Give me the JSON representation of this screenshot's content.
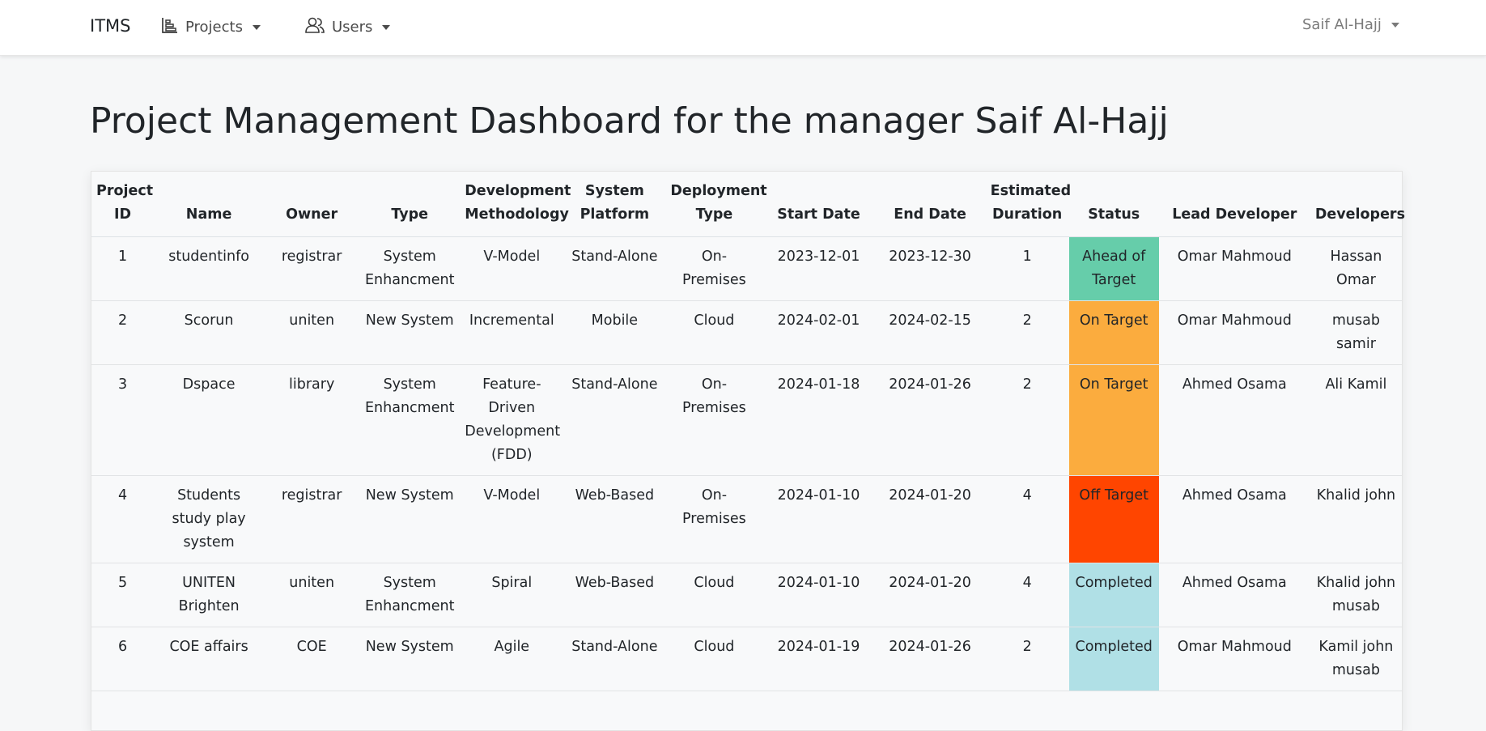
{
  "nav": {
    "brand": "ITMS",
    "projects_label": "Projects",
    "users_label": "Users",
    "user_label": "Saif Al-Hajj"
  },
  "page": {
    "title": "Project Management Dashboard for the manager Saif Al-Hajj"
  },
  "table": {
    "headers": [
      "Project ID",
      "Name",
      "Owner",
      "Type",
      "Development Methodology",
      "System Platform",
      "Deployment Type",
      "Start Date",
      "End Date",
      "Estimated Duration",
      "Status",
      "Lead Developer",
      "Developers"
    ],
    "rows": [
      {
        "id": "1",
        "name": "studentinfo",
        "owner": "registrar",
        "type": "System Enhancment",
        "method": "V-Model",
        "platform": "Stand-Alone",
        "deploy": "On-Premises",
        "start": "2023-12-01",
        "end": "2023-12-30",
        "duration": "1",
        "status": "Ahead of Target",
        "status_color": "#66cdaa",
        "lead": "Omar Mahmoud",
        "devs": "Hassan Omar"
      },
      {
        "id": "2",
        "name": "Scorun",
        "owner": "uniten",
        "type": "New System",
        "method": "Incremental",
        "platform": "Mobile",
        "deploy": "Cloud",
        "start": "2024-02-01",
        "end": "2024-02-15",
        "duration": "2",
        "status": "On Target",
        "status_color": "#fbac3e",
        "lead": "Omar Mahmoud",
        "devs": "musab samir"
      },
      {
        "id": "3",
        "name": "Dspace",
        "owner": "library",
        "type": "System Enhancment",
        "method": "Feature-Driven Development (FDD)",
        "platform": "Stand-Alone",
        "deploy": "On-Premises",
        "start": "2024-01-18",
        "end": "2024-01-26",
        "duration": "2",
        "status": "On Target",
        "status_color": "#fbac3e",
        "lead": "Ahmed Osama",
        "devs": "Ali Kamil"
      },
      {
        "id": "4",
        "name": "Students study play system",
        "owner": "registrar",
        "type": "New System",
        "method": "V-Model",
        "platform": "Web-Based",
        "deploy": "On-Premises",
        "start": "2024-01-10",
        "end": "2024-01-20",
        "duration": "4",
        "status": "Off Target",
        "status_color": "#ff4500",
        "lead": "Ahmed Osama",
        "devs": "Khalid john"
      },
      {
        "id": "5",
        "name": "UNITEN Brighten",
        "owner": "uniten",
        "type": "System Enhancment",
        "method": "Spiral",
        "platform": "Web-Based",
        "deploy": "Cloud",
        "start": "2024-01-10",
        "end": "2024-01-20",
        "duration": "4",
        "status": "Completed",
        "status_color": "#b0e0e6",
        "lead": "Ahmed Osama",
        "devs": "Khalid john musab"
      },
      {
        "id": "6",
        "name": "COE affairs",
        "owner": "COE",
        "type": "New System",
        "method": "Agile",
        "platform": "Stand-Alone",
        "deploy": "Cloud",
        "start": "2024-01-19",
        "end": "2024-01-26",
        "duration": "2",
        "status": "Completed",
        "status_color": "#b0e0e6",
        "lead": "Omar Mahmoud",
        "devs": "Kamil john musab"
      }
    ]
  },
  "icons": {
    "projects": "bar-chart-icon",
    "users": "users-icon"
  }
}
